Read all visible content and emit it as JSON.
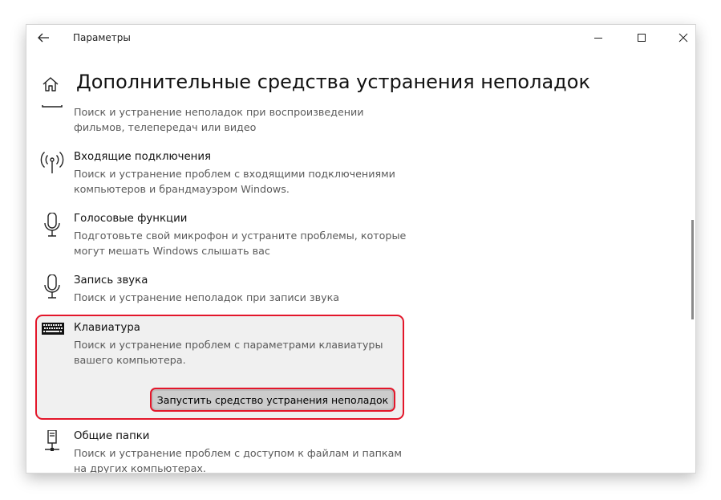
{
  "window": {
    "title": "Параметры",
    "colors": {
      "highlight_border": "#e3162a",
      "selected_bg": "#f0f0f0",
      "button_bg": "#cccccc"
    }
  },
  "page": {
    "title": "Дополнительные средства устранения неполадок"
  },
  "items": [
    {
      "icon": "video-icon",
      "name": "",
      "desc1": "Поиск и устранение неполадок при воспроизведении",
      "desc2": "фильмов, телепередач или видео"
    },
    {
      "icon": "antenna-icon",
      "name": "Входящие подключения",
      "desc1": "Поиск и устранение проблем с входящими подключениями",
      "desc2": "компьютеров и брандмауэром Windows."
    },
    {
      "icon": "microphone-icon",
      "name": "Голосовые функции",
      "desc1": "Подготовьте свой микрофон и устраните проблемы, которые",
      "desc2": "могут мешать Windows слышать вас"
    },
    {
      "icon": "microphone-icon",
      "name": "Запись звука",
      "desc1": "Поиск и устранение неполадок при записи звука",
      "desc2": ""
    },
    {
      "icon": "keyboard-icon",
      "name": "Клавиатура",
      "desc1": "Поиск и устранение проблем с параметрами клавиатуры",
      "desc2": "вашего компьютера.",
      "selected": true
    },
    {
      "icon": "network-share-icon",
      "name": "Общие папки",
      "desc1": "Поиск и устранение проблем с доступом к файлам и папкам",
      "desc2": "на других компьютерах."
    }
  ],
  "run_button": {
    "label": "Запустить средство устранения неполадок"
  }
}
